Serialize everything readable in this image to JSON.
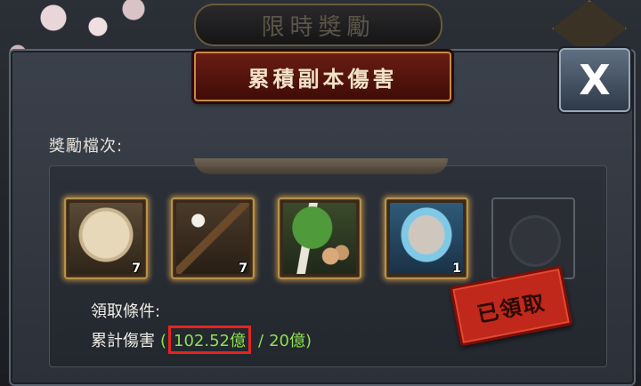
{
  "background": {
    "banner_title": "限時獎勵"
  },
  "modal": {
    "title": "累積副本傷害",
    "close_label": "X",
    "tier_label": "獎勵檔次:",
    "rewards": [
      {
        "icon": "heart-jade-icon",
        "count": "7"
      },
      {
        "icon": "flower-staff-icon",
        "count": "7"
      },
      {
        "icon": "vegetable-egg-basket-icon",
        "count": ""
      },
      {
        "icon": "porridge-bowl-icon",
        "count": "1"
      },
      {
        "icon": "empty-slot-emblem-icon",
        "count": ""
      }
    ],
    "condition_label": "領取條件:",
    "condition": {
      "name": "累計傷害",
      "open_paren": "(",
      "current": "102.52億",
      "separator": "/",
      "target": "20億",
      "close_paren": ")"
    },
    "claimed_stamp": "已領取"
  },
  "colors": {
    "accent_green": "#8ee04e",
    "highlight_red": "#e8231d",
    "stamp_red": "#c0281b",
    "title_plate": "#6a1d14"
  }
}
